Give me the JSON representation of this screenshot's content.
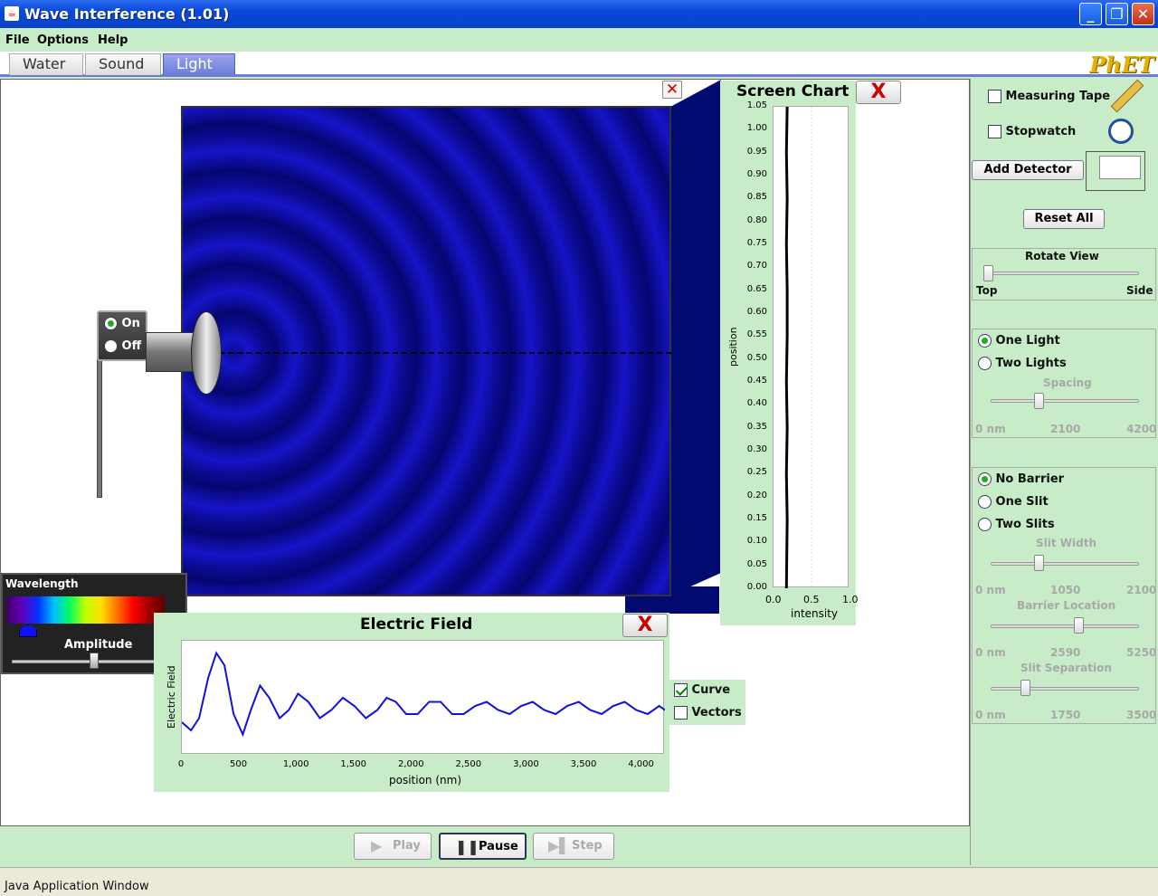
{
  "window": {
    "title": "Wave Interference (1.01)"
  },
  "menu": [
    "File",
    "Options",
    "Help"
  ],
  "tabs": [
    {
      "label": "Water"
    },
    {
      "label": "Sound"
    },
    {
      "label": "Light",
      "active": true
    }
  ],
  "brand": "PhET",
  "source": {
    "on_label": "On",
    "off_label": "Off",
    "state": "On"
  },
  "wavelength_panel": {
    "title": "Wavelength",
    "amplitude_label": "Amplitude",
    "wavelength_color": "#1010ff",
    "amplitude_fraction": 0.5
  },
  "screen_chart": {
    "title": "Screen Chart",
    "close": "X",
    "yticks": [
      "1.05",
      "1.00",
      "0.95",
      "0.90",
      "0.85",
      "0.80",
      "0.75",
      "0.70",
      "0.65",
      "0.60",
      "0.55",
      "0.50",
      "0.45",
      "0.40",
      "0.35",
      "0.30",
      "0.25",
      "0.20",
      "0.15",
      "0.10",
      "0.05",
      "0.00"
    ],
    "xticks": [
      "0.0",
      "0.5",
      "1.0"
    ],
    "ylabel": "position",
    "xlabel": "intensity"
  },
  "electric_field": {
    "title": "Electric Field",
    "close": "X",
    "ylabel": "Electric Field",
    "xlabel": "position (nm)",
    "xticks": [
      "0",
      "500",
      "1,000",
      "1,500",
      "2,000",
      "2,500",
      "3,000",
      "3,500",
      "4,000"
    ]
  },
  "view_options": {
    "curve_label": "Curve",
    "curve_checked": true,
    "vectors_label": "Vectors",
    "vectors_checked": false
  },
  "tools": {
    "measuring_tape": "Measuring Tape",
    "stopwatch": "Stopwatch",
    "add_detector": "Add Detector",
    "reset_all": "Reset All"
  },
  "rotate_view": {
    "title": "Rotate View",
    "left": "Top",
    "right": "Side"
  },
  "lights": {
    "one": "One Light",
    "two": "Two Lights",
    "selected": "One Light",
    "spacing_label": "Spacing",
    "spacing_min": "0 nm",
    "spacing_mid": "2100",
    "spacing_max": "4200"
  },
  "barrier": {
    "none": "No Barrier",
    "one": "One Slit",
    "two": "Two Slits",
    "selected": "No Barrier",
    "slit_width_label": "Slit Width",
    "sw_min": "0 nm",
    "sw_mid": "1050",
    "sw_max": "2100",
    "barrier_loc_label": "Barrier Location",
    "bl_min": "0 nm",
    "bl_mid": "2590",
    "bl_max": "5250",
    "slit_sep_label": "Slit Separation",
    "ss_min": "0 nm",
    "ss_mid": "1750",
    "ss_max": "3500"
  },
  "playback": {
    "play": "Play",
    "pause": "Pause",
    "step": "Step"
  },
  "status": "Java Application Window",
  "chart_data": [
    {
      "type": "line",
      "title": "Screen Chart",
      "xlabel": "intensity",
      "ylabel": "position",
      "xlim": [
        0,
        1
      ],
      "ylim": [
        0,
        1.05
      ],
      "x": [
        0.18,
        0.17,
        0.18,
        0.17,
        0.18,
        0.18,
        0.17,
        0.18,
        0.17,
        0.18,
        0.17
      ],
      "y": [
        1.05,
        0.95,
        0.85,
        0.75,
        0.65,
        0.55,
        0.45,
        0.35,
        0.25,
        0.15,
        0.0
      ]
    },
    {
      "type": "line",
      "title": "Electric Field",
      "xlabel": "position (nm)",
      "ylabel": "Electric Field",
      "xlim": [
        0,
        4200
      ],
      "x": [
        0,
        80,
        150,
        230,
        300,
        370,
        450,
        530,
        600,
        680,
        760,
        850,
        930,
        1010,
        1100,
        1200,
        1300,
        1400,
        1500,
        1600,
        1700,
        1780,
        1860,
        1950,
        2050,
        2150,
        2250,
        2350,
        2450,
        2550,
        2650,
        2750,
        2850,
        2950,
        3050,
        3150,
        3250,
        3350,
        3450,
        3550,
        3650,
        3750,
        3850,
        3950,
        4050,
        4150,
        4200
      ],
      "y": [
        0.3,
        0.1,
        0.4,
        1.4,
        2.0,
        1.7,
        0.5,
        0.0,
        0.6,
        1.2,
        0.9,
        0.4,
        0.6,
        1.0,
        0.8,
        0.4,
        0.6,
        0.9,
        0.7,
        0.4,
        0.6,
        0.9,
        0.8,
        0.5,
        0.5,
        0.8,
        0.8,
        0.5,
        0.5,
        0.7,
        0.8,
        0.6,
        0.5,
        0.7,
        0.8,
        0.6,
        0.5,
        0.7,
        0.8,
        0.6,
        0.5,
        0.7,
        0.8,
        0.6,
        0.5,
        0.7,
        0.6
      ]
    }
  ]
}
